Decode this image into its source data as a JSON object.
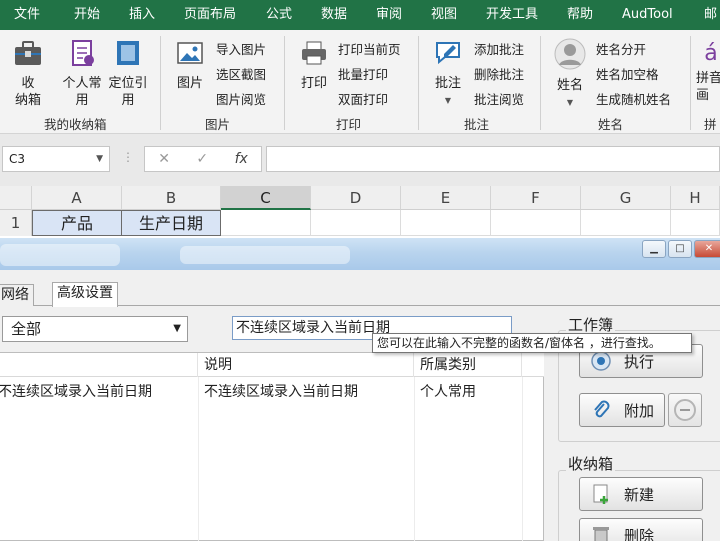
{
  "ribbon_tabs": [
    "文件",
    "开始",
    "插入",
    "页面布局",
    "公式",
    "数据",
    "审阅",
    "视图",
    "开发工具",
    "帮助",
    "AudTool",
    "邮"
  ],
  "ribbon": {
    "groups": {
      "storage_box": "我的收纳箱",
      "picture": "图片",
      "print": "打印",
      "comment": "批注",
      "name": "姓名",
      "pinyin": "拼"
    },
    "big_buttons": {
      "storage": "收\n纳箱",
      "personal": "个人常\n用",
      "locate": "定位引\n用",
      "picture": "图片",
      "print": "打印",
      "comment": "批注",
      "name": "姓名",
      "pinyin": "拼音\n画"
    },
    "small_buttons": {
      "import_pic": "导入图片",
      "area_shot": "选区截图",
      "pic_view": "图片阅览",
      "print_current": "打印当前页",
      "batch_print": "批量打印",
      "duplex_print": "双面打印",
      "add_comment": "添加批注",
      "delete_comment": "删除批注",
      "view_comment": "批注阅览",
      "split_name": "姓名分开",
      "name_space": "姓名加空格",
      "random_name": "生成随机姓名"
    }
  },
  "formula_bar": {
    "name_box": "C3",
    "cancel": "✕",
    "confirm": "✓",
    "fx": "fx",
    "value": ""
  },
  "grid": {
    "columns": [
      "A",
      "B",
      "C",
      "D",
      "E",
      "F",
      "G",
      "H"
    ],
    "selected_column": "C",
    "row_number": "1",
    "cells": {
      "A1": "产品",
      "B1": "生产日期"
    }
  },
  "dialog": {
    "tabs": [
      "网络",
      "高级设置"
    ],
    "category_select": "全部",
    "search_value": "不连续区域录入当前日期",
    "tooltip": "您可以在此输入不完整的函数名/窗体名 ，进行查找。",
    "list_headers": [
      "",
      "说明",
      "所属类别"
    ],
    "list_rows": [
      {
        "name": "不连续区域录入当前日期",
        "desc": "不连续区域录入当前日期",
        "category": "个人常用"
      }
    ],
    "workbook_group": "工作簿",
    "execute_label": "执行",
    "attach_label": "附加",
    "storage_group": "收纳箱",
    "new_label": "新建",
    "delete_label": "删除"
  },
  "colors": {
    "ribbon_green": "#217346",
    "header_fill": "#d9e4f5"
  }
}
